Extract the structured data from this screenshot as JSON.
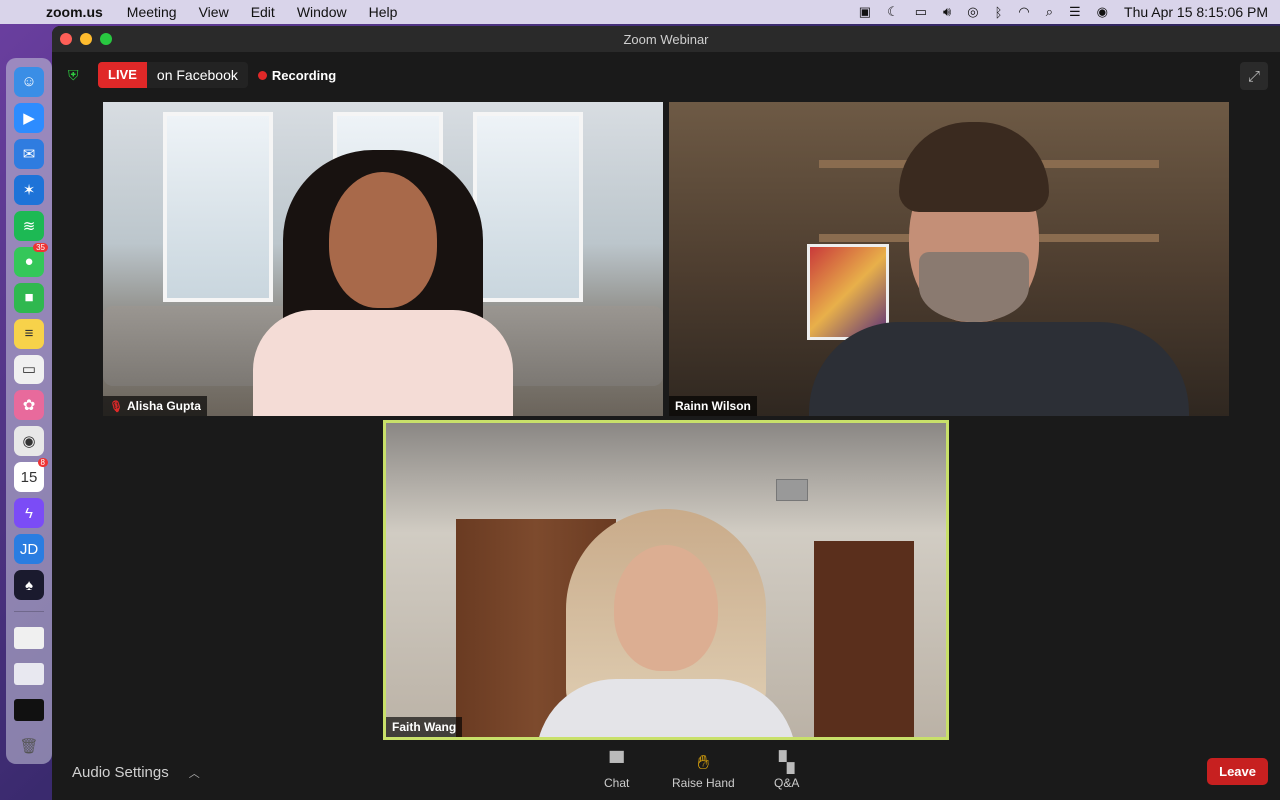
{
  "menubar": {
    "apple_icon": "",
    "app_name": "zoom.us",
    "menus": [
      "Meeting",
      "View",
      "Edit",
      "Window",
      "Help"
    ],
    "status_icons": [
      "zoom-icon",
      "moon-icon",
      "battery-icon",
      "volume-icon",
      "user-icon",
      "bluetooth-icon",
      "wifi-icon",
      "search-icon",
      "control-center-icon",
      "siri-icon"
    ],
    "clock": "Thu Apr 15  8:15:06 PM"
  },
  "dock": {
    "items": [
      {
        "name": "finder-icon",
        "color": "#3a8ee6",
        "glyph": "☺"
      },
      {
        "name": "zoom-icon",
        "color": "#2d8cff",
        "glyph": "▶"
      },
      {
        "name": "mail-icon",
        "color": "#2f7ce0",
        "glyph": "✉"
      },
      {
        "name": "safari-icon",
        "color": "#1e73d8",
        "glyph": "✶"
      },
      {
        "name": "spotify-icon",
        "color": "#1db954",
        "glyph": "≋"
      },
      {
        "name": "messages-icon",
        "color": "#34c759",
        "glyph": "●",
        "badge": "35"
      },
      {
        "name": "facetime-icon",
        "color": "#2fb84f",
        "glyph": "■"
      },
      {
        "name": "notes-icon",
        "color": "#f7d24a",
        "glyph": "≡"
      },
      {
        "name": "stickies-icon",
        "color": "#f0f0f0",
        "glyph": "▭"
      },
      {
        "name": "photos-icon",
        "color": "#e86a9c",
        "glyph": "✿"
      },
      {
        "name": "chrome-icon",
        "color": "#e8e8e8",
        "glyph": "◉"
      },
      {
        "name": "calendar-icon",
        "color": "#ffffff",
        "glyph": "15",
        "badge": "8"
      },
      {
        "name": "messenger-icon",
        "color": "#7b4cf6",
        "glyph": "ϟ"
      },
      {
        "name": "just-dance-icon",
        "color": "#2a7de1",
        "glyph": "JD"
      },
      {
        "name": "app-icon",
        "color": "#1a1a2e",
        "glyph": "♠"
      }
    ],
    "minimized": [
      {
        "name": "minimized-window-icon",
        "color": "#f0f0f0"
      },
      {
        "name": "minimized-window-icon",
        "color": "#e8e8f0"
      },
      {
        "name": "minimized-window-icon",
        "color": "#111111"
      }
    ],
    "trash": {
      "name": "trash-icon",
      "color": "#c8c8c8"
    }
  },
  "window": {
    "title": "Zoom Webinar",
    "live_label": "LIVE",
    "live_destination": "on Facebook",
    "recording_label": "Recording",
    "accent_live": "#e02828",
    "active_speaker_border": "#c8e06a"
  },
  "participants": [
    {
      "name": "Alisha Gupta",
      "muted": true
    },
    {
      "name": "Rainn Wilson",
      "muted": false
    },
    {
      "name": "Faith Wang",
      "muted": false,
      "active_speaker": true
    }
  ],
  "toolbar": {
    "audio_settings": "Audio Settings",
    "chat": "Chat",
    "raise_hand": "Raise Hand",
    "qa": "Q&A",
    "leave": "Leave"
  }
}
